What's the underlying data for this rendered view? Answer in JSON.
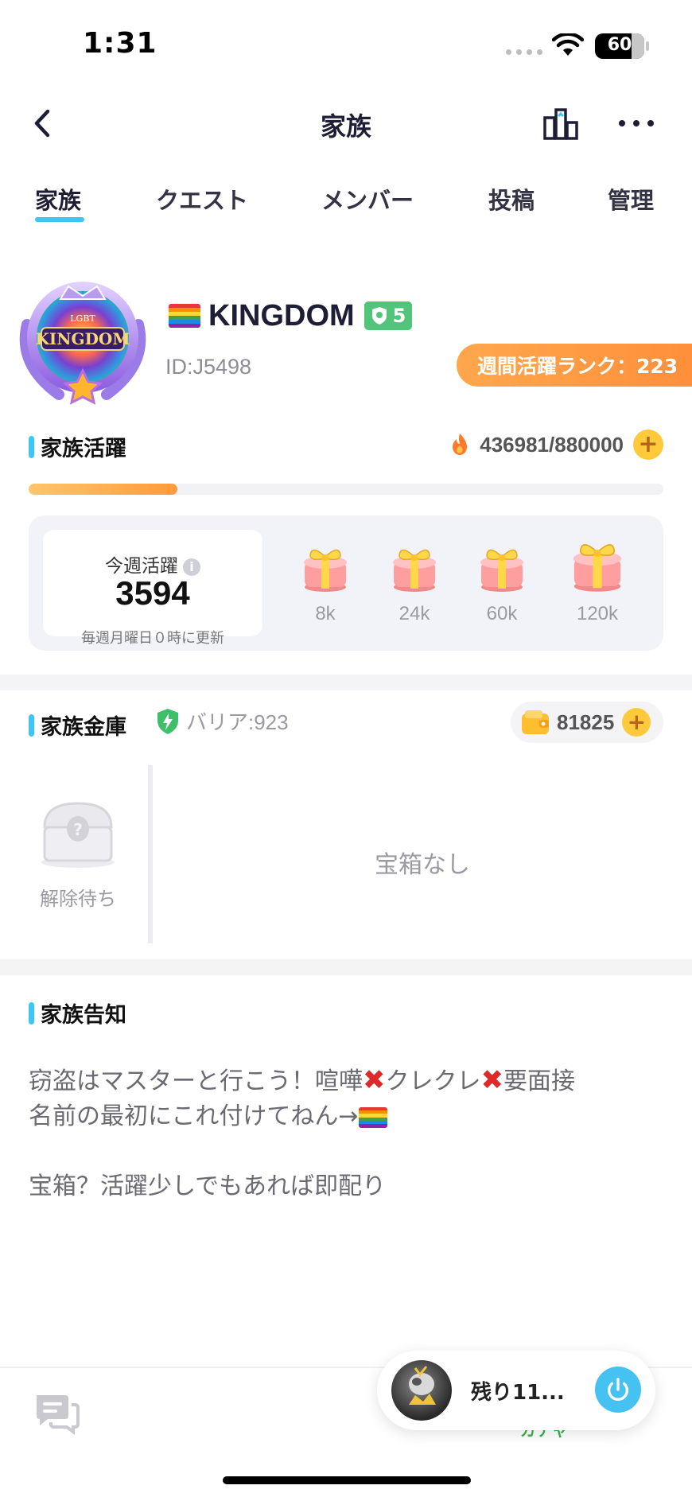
{
  "status_bar": {
    "time": "1:31",
    "battery": "60",
    "battery_level_percent": 60
  },
  "nav": {
    "title": "家族",
    "icons": [
      "chevron-left-icon",
      "ranking-icon",
      "more-icon"
    ]
  },
  "tabs": [
    {
      "label": "家族",
      "active": true
    },
    {
      "label": "クエスト",
      "active": false
    },
    {
      "label": "メンバー",
      "active": false
    },
    {
      "label": "投稿",
      "active": false
    },
    {
      "label": "管理",
      "active": false
    }
  ],
  "family": {
    "badge_text": "KINGDOM",
    "badge_subtext": "LGBT",
    "name": "KINGDOM",
    "level": "5",
    "id": "ID:J5498",
    "weekly_rank": "週間活躍ランク：223"
  },
  "activity": {
    "heading": "家族活躍",
    "progress_text": "436981/880000",
    "progress_fraction": 0.2343,
    "weekly_label": "今週活躍",
    "weekly_value": "3594",
    "weekly_note": "毎週月曜日０時に更新",
    "rewards": [
      {
        "label": "8k"
      },
      {
        "label": "24k"
      },
      {
        "label": "60k"
      },
      {
        "label": "120k"
      }
    ]
  },
  "vault": {
    "heading": "家族金庫",
    "barrier": "バリア:923",
    "coins": "81825",
    "chest_label": "解除待ち",
    "empty_text": "宝箱なし"
  },
  "notice": {
    "heading": "家族告知",
    "line1_a": "窃盗はマスターと行こう！喧嘩",
    "line1_b": "クレクレ",
    "line1_c": "要面接",
    "line2": "名前の最初にこれ付けてねん→",
    "line3": "宝箱？活躍少しでもあれば即配り"
  },
  "bottom": {
    "gacha_peek": "ガチャ",
    "float_text": "残り11..."
  },
  "colors": {
    "accent": "#3dc7f0",
    "rank_pill": "#ff9a3a",
    "level_badge": "#53c57b",
    "coin": "#ffc93c"
  }
}
